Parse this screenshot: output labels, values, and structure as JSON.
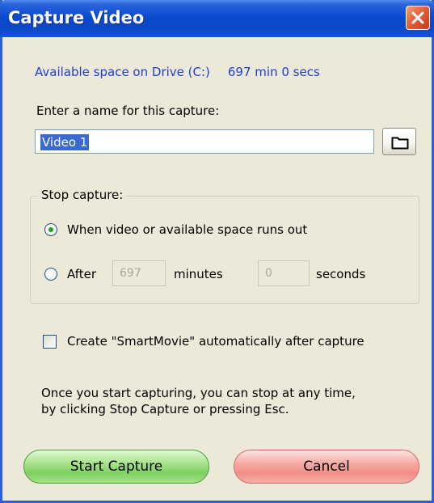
{
  "window": {
    "title": "Capture Video"
  },
  "space": {
    "label": "Available space on Drive (C:)",
    "value": "697 min 0 secs"
  },
  "name_field": {
    "label": "Enter a name for this capture:",
    "value": "Video 1"
  },
  "stop_capture": {
    "title": "Stop capture:",
    "option_runs_out": "When video or available space runs out",
    "option_after": "After",
    "minutes_value": "697",
    "minutes_label": "minutes",
    "seconds_value": "0",
    "seconds_label": "seconds",
    "selected": "runs_out"
  },
  "smartmovie": {
    "label": "Create \"SmartMovie\" automatically after capture",
    "checked": false
  },
  "info": {
    "line1": "Once you start capturing, you can stop at any time,",
    "line2": "by clicking Stop Capture or pressing Esc."
  },
  "buttons": {
    "start": "Start Capture",
    "cancel": "Cancel"
  },
  "icons": {
    "close": "close-icon",
    "folder": "folder-icon"
  },
  "colors": {
    "titlebar": "#0a48c8",
    "dialog_bg": "#ece9d8",
    "accent_text": "#1f3ed4",
    "start_button": "#7fd060",
    "cancel_button": "#f08e88"
  }
}
